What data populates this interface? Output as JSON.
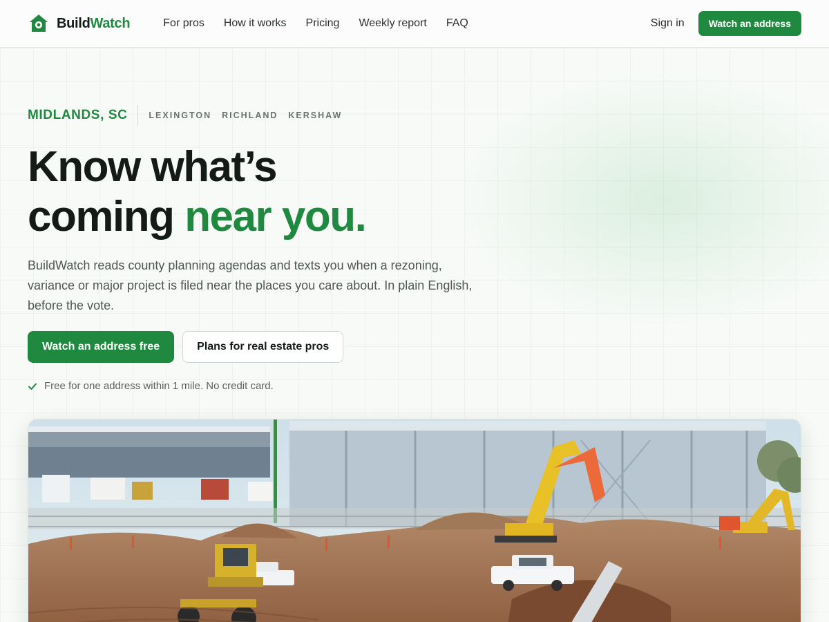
{
  "brand": {
    "name_part1": "Build",
    "name_part2": "Watch",
    "logo_icon": "house-eye-icon",
    "accent_color": "#1f8a3f"
  },
  "nav": {
    "links": [
      "For pros",
      "How it works",
      "Pricing",
      "Weekly report",
      "FAQ"
    ],
    "sign_in": "Sign in",
    "cta": "Watch an address"
  },
  "hero": {
    "region": "MIDLANDS, SC",
    "counties": [
      "LEXINGTON",
      "RICHLAND",
      "KERSHAW"
    ],
    "headline_line1": "Know what’s",
    "headline_line2_plain": "coming ",
    "headline_line2_accent": "near you.",
    "lede": "BuildWatch reads county planning agendas and texts you when a rezoning, variance or major project is filed near the places you care about. In plain English, before the vote.",
    "primary_cta": "Watch an address free",
    "secondary_cta": "Plans for real estate pros",
    "note_icon": "check-icon",
    "note": "Free for one address within 1 mile. No credit card."
  },
  "photo": {
    "subject": "construction-site-photo"
  }
}
